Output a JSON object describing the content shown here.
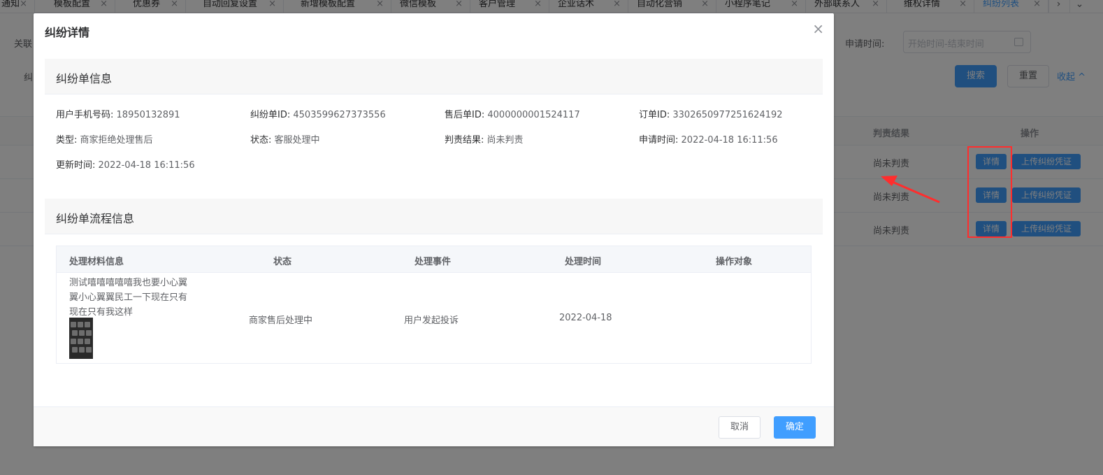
{
  "tabs": [
    {
      "label": "通知"
    },
    {
      "label": "模板配置"
    },
    {
      "label": "优惠券"
    },
    {
      "label": "自动回复设置"
    },
    {
      "label": "新增模板配置"
    },
    {
      "label": "微信模板"
    },
    {
      "label": "客户管理"
    },
    {
      "label": "企业话术"
    },
    {
      "label": "自动化营销"
    },
    {
      "label": "小程序笔记"
    },
    {
      "label": "外部联系人"
    },
    {
      "label": "维权详情"
    },
    {
      "label": "纠纷列表",
      "active": true
    }
  ],
  "tab_close_glyph": "×",
  "tab_scroll_right_glyph": "›",
  "tab_dropdown_glyph": "⌄",
  "filters": {
    "partial_label_1": "关联",
    "partial_label_2": "纠",
    "apply_time_label": "申请时间:",
    "date_range_placeholder": "开始时间-结束时间",
    "search_button": "搜索",
    "reset_button": "重置",
    "collapse_link": "收起 ^"
  },
  "list": {
    "columns": {
      "judge_result": "判责结果",
      "action": "操作"
    },
    "rows": [
      {
        "judge_result": "尚未判责",
        "detail_button": "详情",
        "upload_button": "上传纠纷凭证"
      },
      {
        "judge_result": "尚未判责",
        "detail_button": "详情",
        "upload_button": "上传纠纷凭证"
      },
      {
        "judge_result": "尚未判责",
        "detail_button": "详情",
        "upload_button": "上传纠纷凭证"
      }
    ]
  },
  "annotation_color": "#ff2d2d",
  "dialog": {
    "title": "纠纷详情",
    "close_glyph": "×",
    "info_section_title": "纠纷单信息",
    "fields": [
      {
        "label": "用户手机号码:",
        "value": "18950132891"
      },
      {
        "label": "纠纷单ID:",
        "value": "4503599627373556"
      },
      {
        "label": "售后单ID:",
        "value": "4000000001524117"
      },
      {
        "label": "订单ID:",
        "value": "3302650977251624192"
      },
      {
        "label": "类型:",
        "value": "商家拒绝处理售后"
      },
      {
        "label": "状态:",
        "value": "客服处理中"
      },
      {
        "label": "判责结果:",
        "value": "尚未判责"
      },
      {
        "label": "申请时间:",
        "value": "2022-04-18 16:11:56"
      },
      {
        "label": "更新时间:",
        "value": "2022-04-18 16:11:56"
      }
    ],
    "flow_section_title": "纠纷单流程信息",
    "flow_table": {
      "headers": [
        "处理材料信息",
        "状态",
        "处理事件",
        "处理时间",
        "操作对象"
      ],
      "rows": [
        {
          "material_text": "测试嘻嘻嘻嘻嘻我也要小心翼翼小心翼翼民工一下现在只有现在只有我这样",
          "status": "商家售后处理中",
          "event": "用户发起投诉",
          "time": "2022-04-18",
          "operator": ""
        }
      ]
    },
    "footer": {
      "cancel_button": "取消",
      "confirm_button": "确定"
    }
  },
  "colors": {
    "primary": "#409eff",
    "overlay": "rgba(0,0,0,0.5)"
  }
}
